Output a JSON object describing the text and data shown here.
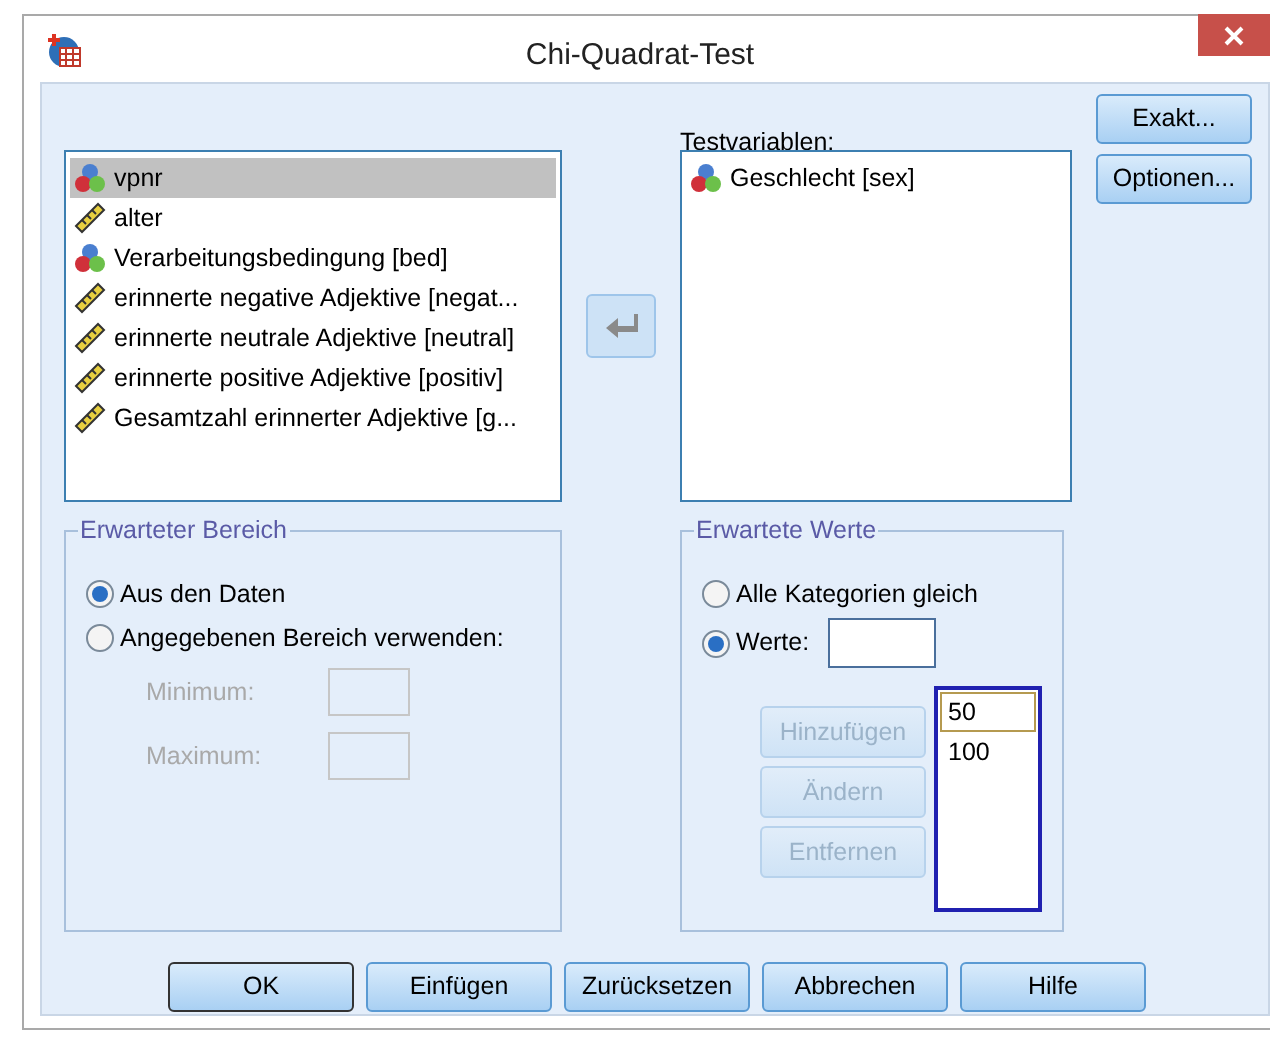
{
  "window": {
    "title": "Chi-Quadrat-Test"
  },
  "variables": [
    {
      "name": "vpnr",
      "kind": "nominal",
      "selected": true
    },
    {
      "name": "alter",
      "kind": "scale",
      "selected": false
    },
    {
      "name": "Verarbeitungsbedingung [bed]",
      "kind": "nominal",
      "selected": false
    },
    {
      "name": "erinnerte negative Adjektive [negat...",
      "kind": "scale",
      "selected": false
    },
    {
      "name": "erinnerte neutrale Adjektive [neutral]",
      "kind": "scale",
      "selected": false
    },
    {
      "name": "erinnerte positive Adjektive [positiv]",
      "kind": "scale",
      "selected": false
    },
    {
      "name": "Gesamtzahl erinnerter Adjektive [g...",
      "kind": "scale",
      "selected": false
    }
  ],
  "test_variables": {
    "label": "Testvariablen:",
    "items": [
      {
        "name": "Geschlecht [sex]",
        "kind": "nominal"
      }
    ]
  },
  "side_buttons": [
    "Exakt...",
    "Optionen..."
  ],
  "expected_range": {
    "title": "Erwarteter Bereich",
    "options": [
      {
        "label": "Aus den Daten",
        "selected": true
      },
      {
        "label": "Angegebenen Bereich verwenden:",
        "selected": false
      }
    ],
    "fields": [
      {
        "label": "Minimum:",
        "disabled": true
      },
      {
        "label": "Maximum:",
        "disabled": true
      }
    ]
  },
  "expected_values": {
    "title": "Erwartete Werte",
    "options": [
      {
        "label": "Alle Kategorien gleich",
        "selected": false
      },
      {
        "label": "Werte:",
        "selected": true
      }
    ],
    "buttons": [
      {
        "label": "Hinzufügen",
        "disabled": true
      },
      {
        "label": "Ändern",
        "disabled": true
      },
      {
        "label": "Entfernen",
        "disabled": true
      }
    ],
    "values": [
      {
        "text": "50",
        "focused": true
      },
      {
        "text": "100",
        "focused": false
      }
    ]
  },
  "buttons": [
    {
      "label": "OK",
      "default": true
    },
    {
      "label": "Einfügen",
      "default": false
    },
    {
      "label": "Zurücksetzen",
      "default": false
    },
    {
      "label": "Abbrechen",
      "default": false
    },
    {
      "label": "Hilfe",
      "default": false
    }
  ]
}
